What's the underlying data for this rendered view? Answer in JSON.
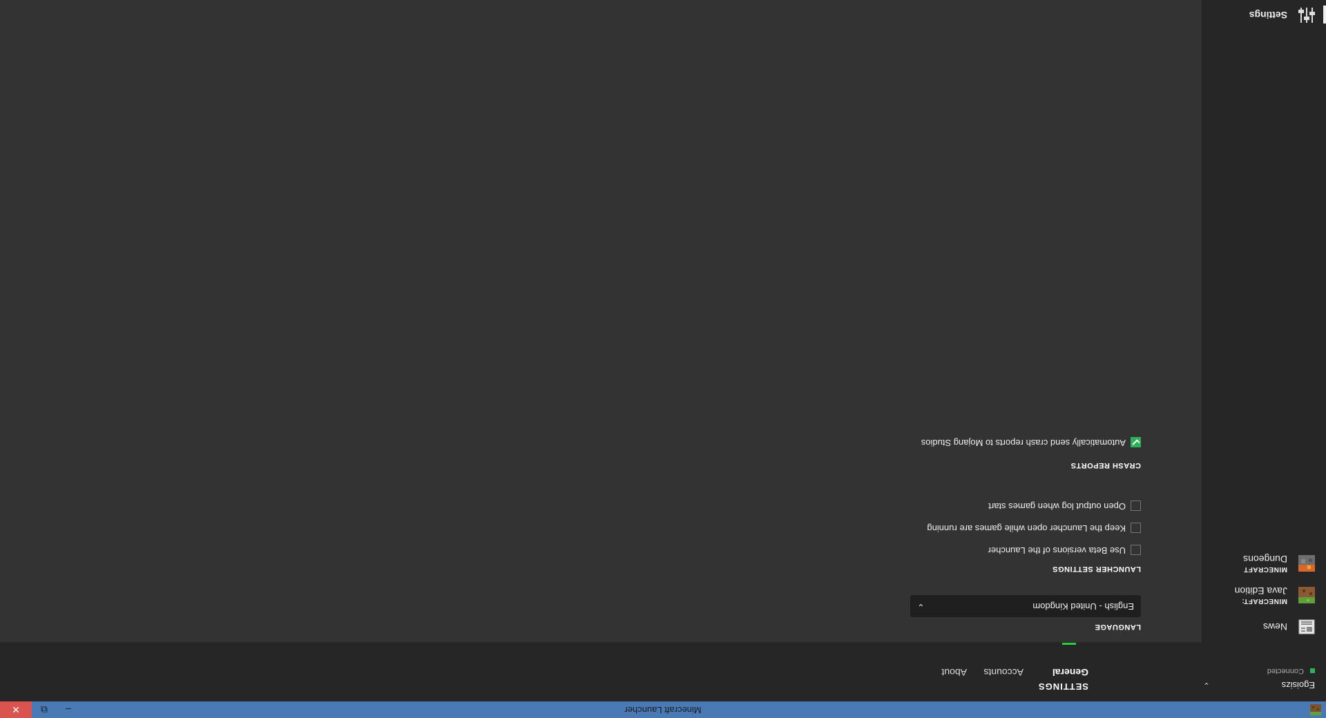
{
  "window": {
    "title": "Minecraft Launcher",
    "minimize_glyph": "–",
    "maximize_glyph": "⧉",
    "close_glyph": "✕"
  },
  "sidebar": {
    "user": {
      "name": "Egoisizs",
      "status": "Connected",
      "status_color": "#2fb05a"
    },
    "items": [
      {
        "label": "News",
        "icon": "news-icon"
      },
      {
        "brand": "MINECRAFT:",
        "label": "Java Edition",
        "icon": "java-edition-icon"
      },
      {
        "brand": "MINECRAFT",
        "label": "Dungeons",
        "icon": "dungeons-icon"
      }
    ],
    "settings": {
      "label": "Settings",
      "icon": "settings-sliders-icon"
    }
  },
  "header": {
    "title": "SETTINGS",
    "tabs": [
      {
        "label": "General",
        "active": true
      },
      {
        "label": "Accounts",
        "active": false
      },
      {
        "label": "About",
        "active": false
      }
    ],
    "accent_color": "#27ce40"
  },
  "general": {
    "language": {
      "title": "LANGUAGE",
      "selected": "English - United Kingdom"
    },
    "launcher_settings": {
      "title": "LAUNCHER SETTINGS",
      "options": [
        {
          "label": "Use Beta versions of the Launcher",
          "checked": false
        },
        {
          "label": "Keep the Launcher open while games are running",
          "checked": false
        },
        {
          "label": "Open output log when games start",
          "checked": false
        }
      ]
    },
    "crash_reports": {
      "title": "CRASH REPORTS",
      "options": [
        {
          "label": "Automatically send crash reports to Mojang Studios",
          "checked": true
        }
      ]
    }
  }
}
